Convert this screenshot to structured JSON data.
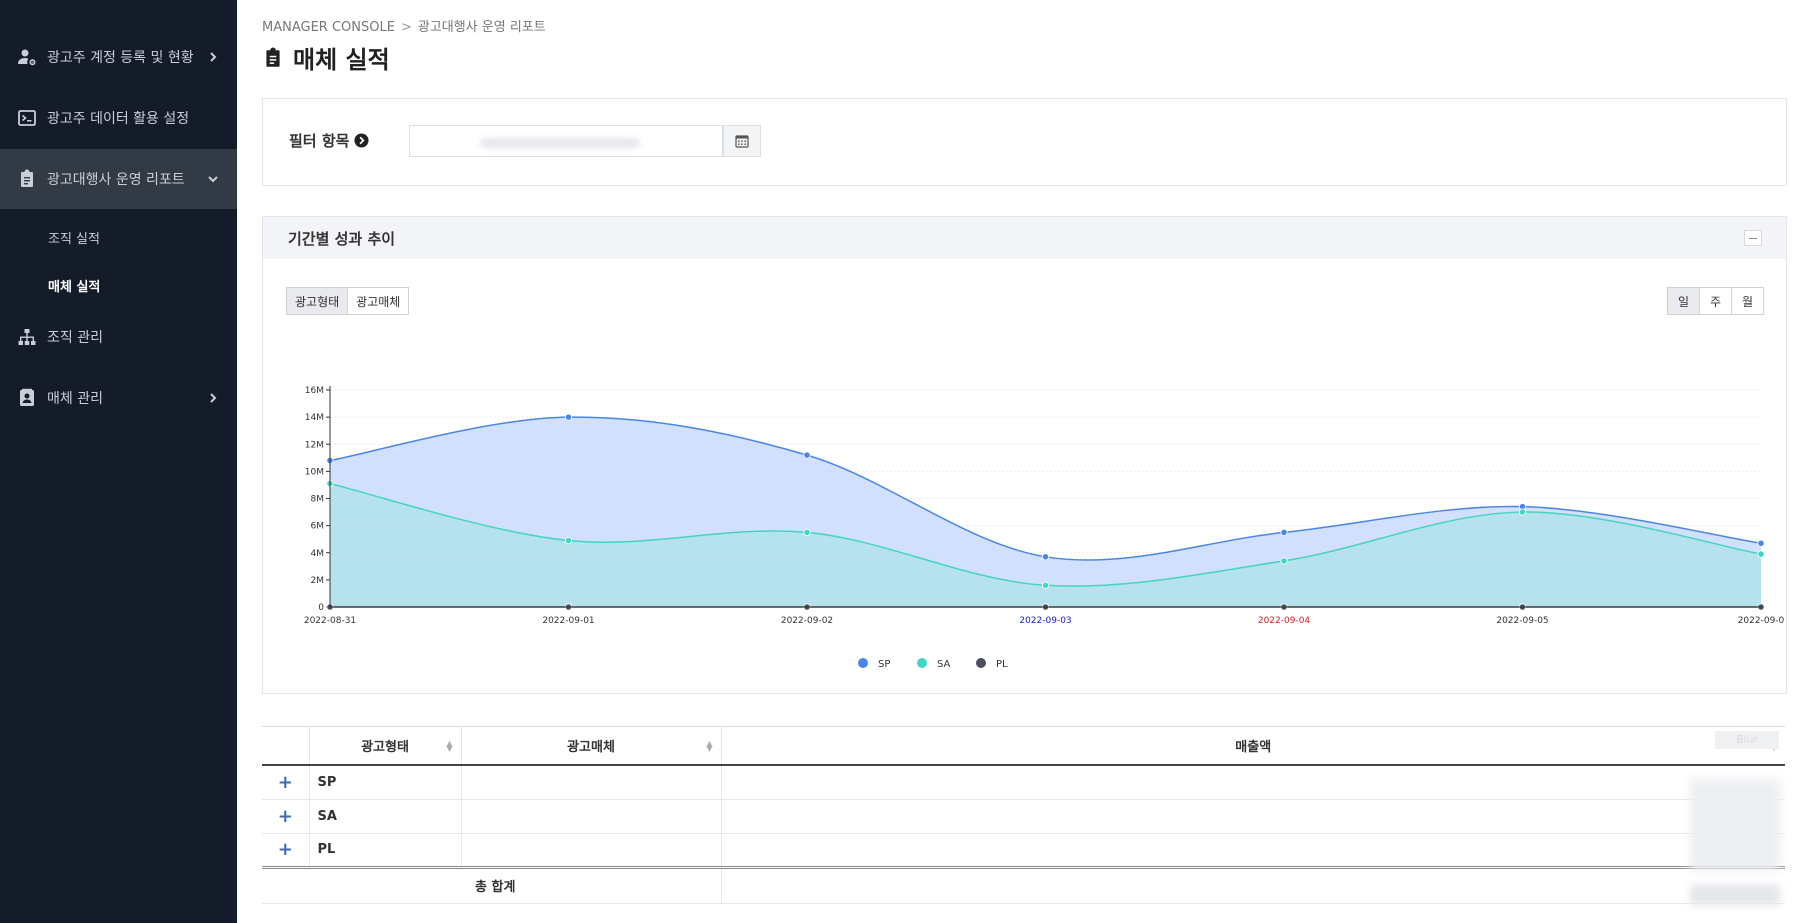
{
  "sidebar": {
    "items": [
      {
        "label": "광고주 계정 등록 및 현황",
        "icon": "user-gear-icon"
      },
      {
        "label": "광고주 데이터 활용 설정",
        "icon": "terminal-icon"
      },
      {
        "label": "광고대행사 운영 리포트",
        "icon": "clipboard-icon"
      },
      {
        "label": "조직 관리",
        "icon": "org-chart-icon"
      },
      {
        "label": "매체 관리",
        "icon": "contact-card-icon"
      }
    ],
    "sub_items": [
      "조직 실적",
      "매체 실적"
    ]
  },
  "breadcrumb": {
    "root": "MANAGER CONSOLE",
    "sep": ">",
    "current": "광고대행사 운영 리포트"
  },
  "page_title": "매체 실적",
  "filter": {
    "label": "필터 항목"
  },
  "chart_panel": {
    "title": "기간별 성과 추이",
    "left_buttons": [
      "광고형태",
      "광고매체"
    ],
    "right_buttons": [
      "일",
      "주",
      "월"
    ]
  },
  "chart_data": {
    "type": "area",
    "x": [
      "2022-08-31",
      "2022-09-01",
      "2022-09-02",
      "2022-09-03",
      "2022-09-04",
      "2022-09-05",
      "2022-09-0"
    ],
    "x_label_colors": [
      "#333333",
      "#333333",
      "#333333",
      "#1a1acc",
      "#d42020",
      "#333333",
      "#333333"
    ],
    "y_ticks": [
      "0",
      "2M",
      "4M",
      "6M",
      "8M",
      "10M",
      "12M",
      "14M",
      "16M"
    ],
    "ylim": [
      0,
      16000000
    ],
    "series": [
      {
        "name": "SP",
        "color": "#4a86e8",
        "fill": "#c9dafb",
        "values": [
          10800000,
          14000000,
          11200000,
          3700000,
          5500000,
          7400000,
          4700000
        ]
      },
      {
        "name": "SA",
        "color": "#45d4c0",
        "fill": "#b2e2ea",
        "values": [
          9100000,
          4900000,
          5500000,
          1600000,
          3400000,
          7000000,
          3900000
        ]
      },
      {
        "name": "PL",
        "color": "#4a5060",
        "fill": "none",
        "values": [
          0,
          0,
          0,
          0,
          0,
          0,
          0
        ]
      }
    ],
    "grid": true,
    "legend": "bottom-center"
  },
  "table": {
    "headers": [
      "광고형태",
      "광고매체",
      "매출액"
    ],
    "rows": [
      {
        "type": "SP"
      },
      {
        "type": "SA"
      },
      {
        "type": "PL"
      }
    ],
    "total_label": "총 합계",
    "blur_tag": "Blur"
  }
}
